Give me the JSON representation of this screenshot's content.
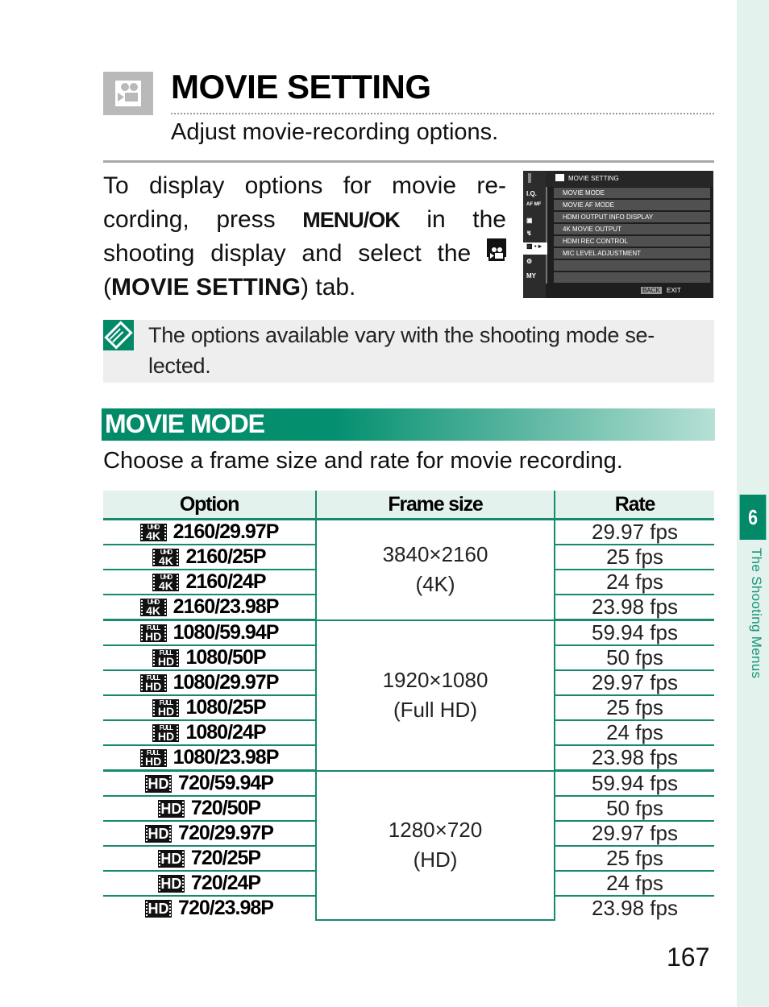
{
  "header": {
    "icon": "movie-camera-icon",
    "title": "MOVIE SETTING",
    "subtitle": "Adjust movie-recording options."
  },
  "intro": {
    "part1": "To display options for movie re-cording, press ",
    "button": "MENU/OK",
    "part2": " in the shooting display and select the ",
    "part3": " (",
    "tab_name": "MOVIE SETTING",
    "part4": ") tab."
  },
  "camera_screen": {
    "title": "MOVIE SETTING",
    "tabs": [
      "I.Q.",
      "AF MF",
      "camera-icon",
      "flash-icon",
      "movie-icon",
      "wrench-icon",
      "MY"
    ],
    "selected_tab": "movie-icon",
    "items": [
      "MOVIE MODE",
      "MOVIE AF MODE",
      "HDMI OUTPUT INFO DISPLAY",
      "4K MOVIE OUTPUT",
      "HDMI REC CONTROL",
      "MIC LEVEL ADJUSTMENT",
      "",
      ""
    ],
    "back_label": "BACK",
    "exit_label": "EXIT"
  },
  "note": {
    "icon": "note-icon",
    "text": "The options available vary with the shooting mode se-lected."
  },
  "section": {
    "title": "MOVIE MODE",
    "description": "Choose a frame size and rate for movie recording."
  },
  "table": {
    "headers": [
      "Option",
      "Frame size",
      "Rate"
    ],
    "groups": [
      {
        "badge": "UHD 4K",
        "frame_size": "3840×2160",
        "frame_label": "(4K)",
        "rows": [
          {
            "option": "2160/29.97P",
            "rate": "29.97 fps"
          },
          {
            "option": "2160/25P",
            "rate": "25 fps"
          },
          {
            "option": "2160/24P",
            "rate": "24 fps"
          },
          {
            "option": "2160/23.98P",
            "rate": "23.98 fps"
          }
        ]
      },
      {
        "badge": "FULL HD",
        "frame_size": "1920×1080",
        "frame_label": "(Full HD)",
        "rows": [
          {
            "option": "1080/59.94P",
            "rate": "59.94 fps"
          },
          {
            "option": "1080/50P",
            "rate": "50 fps"
          },
          {
            "option": "1080/29.97P",
            "rate": "29.97 fps"
          },
          {
            "option": "1080/25P",
            "rate": "25 fps"
          },
          {
            "option": "1080/24P",
            "rate": "24 fps"
          },
          {
            "option": "1080/23.98P",
            "rate": "23.98 fps"
          }
        ]
      },
      {
        "badge": "HD",
        "frame_size": "1280×720",
        "frame_label": "(HD)",
        "rows": [
          {
            "option": "720/59.94P",
            "rate": "59.94 fps"
          },
          {
            "option": "720/50P",
            "rate": "50 fps"
          },
          {
            "option": "720/29.97P",
            "rate": "29.97 fps"
          },
          {
            "option": "720/25P",
            "rate": "25 fps"
          },
          {
            "option": "720/24P",
            "rate": "24 fps"
          },
          {
            "option": "720/23.98P",
            "rate": "23.98 fps"
          }
        ]
      }
    ]
  },
  "chapter": {
    "number": "6",
    "label": "The Shooting Menus"
  },
  "page_number": "167",
  "colors": {
    "accent": "#028a68",
    "table_rule": "#168a6e",
    "header_fill": "#e4f2ee",
    "note_fill": "#eeeeee"
  }
}
